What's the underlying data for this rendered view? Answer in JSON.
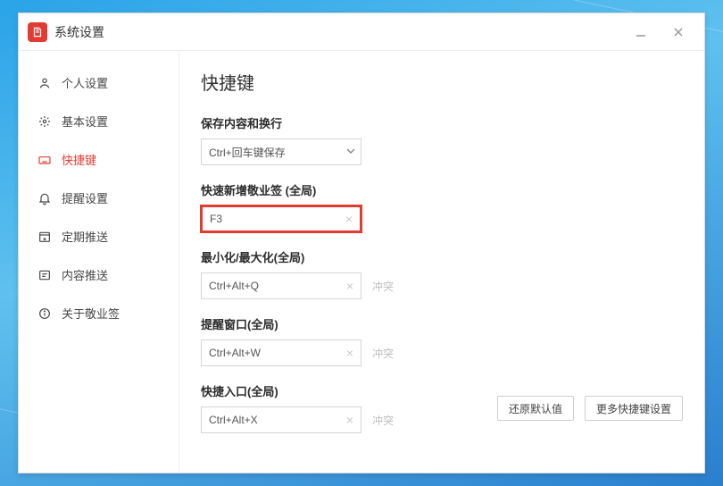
{
  "window": {
    "title": "系统设置"
  },
  "sidebar": {
    "items": [
      {
        "label": "个人设置"
      },
      {
        "label": "基本设置"
      },
      {
        "label": "快捷键"
      },
      {
        "label": "提醒设置"
      },
      {
        "label": "定期推送"
      },
      {
        "label": "内容推送"
      },
      {
        "label": "关于敬业签"
      }
    ]
  },
  "page": {
    "title": "快捷键",
    "sections": {
      "save": {
        "label": "保存内容和换行",
        "value": "Ctrl+回车键保存"
      },
      "newNote": {
        "label": "快速新增敬业签 (全局)",
        "value": "F3"
      },
      "minmax": {
        "label": "最小化/最大化(全局)",
        "value": "Ctrl+Alt+Q",
        "status": "冲突"
      },
      "remind": {
        "label": "提醒窗口(全局)",
        "value": "Ctrl+Alt+W",
        "status": "冲突"
      },
      "entry": {
        "label": "快捷入口(全局)",
        "value": "Ctrl+Alt+X",
        "status": "冲突"
      }
    },
    "buttons": {
      "restore": "还原默认值",
      "more": "更多快捷键设置"
    }
  }
}
